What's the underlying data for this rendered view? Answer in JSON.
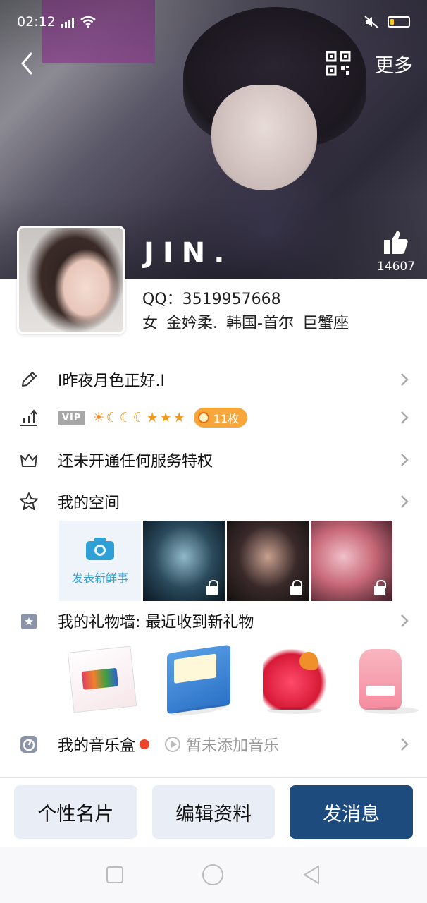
{
  "status_bar": {
    "time": "02:12",
    "network": "4G"
  },
  "header": {
    "more_label": "更多"
  },
  "profile": {
    "nickname": "JIN.",
    "likes": "14607",
    "qq": "QQ：3519957668",
    "gender": "女",
    "name": "金妗柔.",
    "location": "韩国-首尔",
    "zodiac": "巨蟹座"
  },
  "rows": {
    "signature": "I昨夜月色正好.I",
    "vip_label": "VIP",
    "coin_count": "11枚",
    "privilege": "还未开通任何服务特权",
    "space": "我的空间",
    "post_new": "发表新鲜事",
    "gift_wall": "我的礼物墙: 最近收到新礼物",
    "music_box": "我的音乐盒",
    "music_empty": "暂未添加音乐"
  },
  "actions": {
    "card": "个性名片",
    "edit": "编辑资料",
    "message": "发消息"
  },
  "colors": {
    "primary": "#1d4b7d",
    "secondary_btn": "#e9eef6",
    "accent_blue": "#2ea0d6",
    "coin": "#f7a63a",
    "music_dot": "#f0442a"
  }
}
